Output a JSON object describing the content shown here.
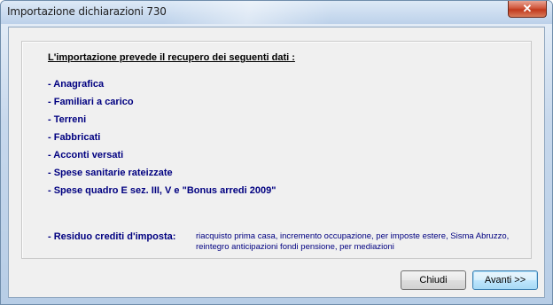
{
  "window": {
    "title": "Importazione dichiarazioni 730",
    "close_glyph": "✕"
  },
  "content": {
    "heading": "L'importazione prevede il recupero dei seguenti dati :",
    "items": [
      "- Anagrafica",
      "- Familiari a carico",
      "- Terreni",
      "- Fabbricati",
      "- Acconti versati",
      "- Spese sanitarie rateizzate",
      "- Spese quadro E sez. III, V e \"Bonus arredi 2009\""
    ],
    "residuo": {
      "label": "- Residuo crediti d'imposta:",
      "detail": "riacquisto prima casa, incremento occupazione, per imposte estere, Sisma Abruzzo, reintegro anticipazioni fondi pensione, per mediazioni"
    }
  },
  "buttons": {
    "close_label": "Chiudi",
    "next_label": "Avanti >>"
  },
  "colors": {
    "item_text": "#000080",
    "dialog_bg": "#f0f0f0",
    "default_button_border": "#3c7fb1"
  }
}
